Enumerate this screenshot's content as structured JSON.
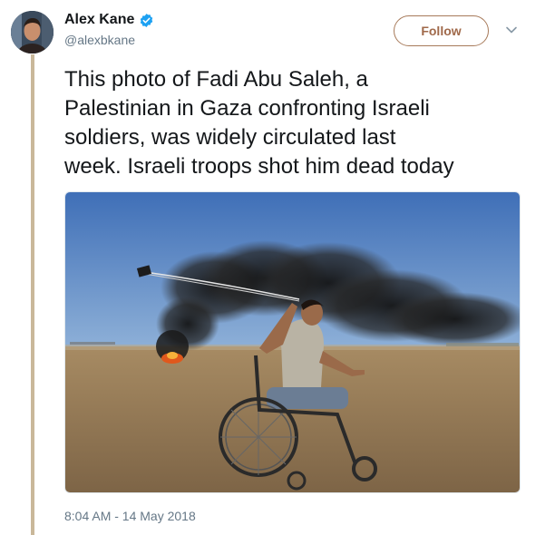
{
  "tweet": {
    "author": {
      "display_name": "Alex Kane",
      "handle": "@alexbkane",
      "verified": true,
      "avatar_icon": "avatar-photo"
    },
    "follow_label": "Follow",
    "menu_icon": "chevron-down-icon",
    "text_lines": [
      "This photo of Fadi Abu Saleh, a",
      "Palestinian in Gaza confronting Israeli",
      "soldiers, was widely circulated last",
      "week. Israeli troops shot him dead today"
    ],
    "timestamp": "8:04 AM - 14 May 2018"
  },
  "colors": {
    "accent": "#a0694a",
    "verified_blue": "#1da1f2",
    "thread_line": "#c9b89a",
    "secondary_text": "#657786"
  }
}
